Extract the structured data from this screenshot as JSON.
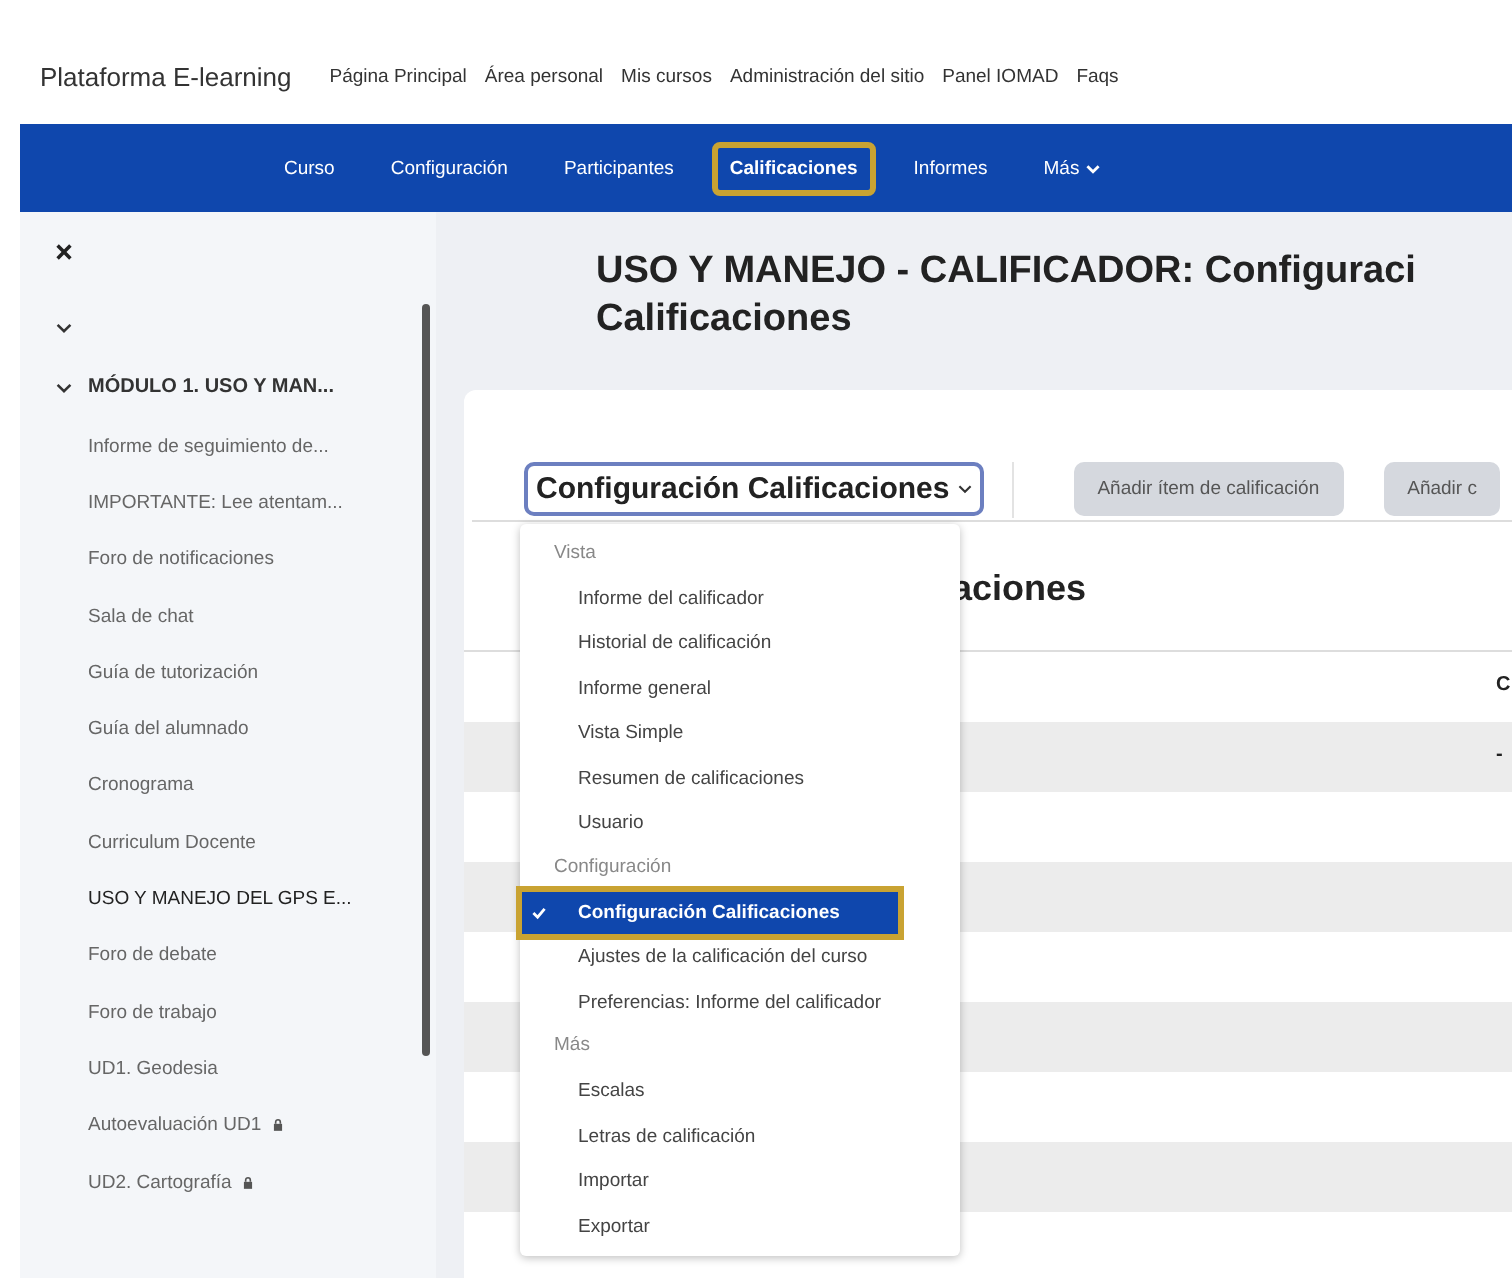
{
  "site_name": "Plataforma E-learning",
  "top_nav": [
    "Página Principal",
    "Área personal",
    "Mis cursos",
    "Administración del sitio",
    "Panel IOMAD",
    "Faqs"
  ],
  "course_nav": [
    {
      "label": "Curso",
      "selected": false
    },
    {
      "label": "Configuración",
      "selected": false
    },
    {
      "label": "Participantes",
      "selected": false
    },
    {
      "label": "Calificaciones",
      "selected": true
    },
    {
      "label": "Informes",
      "selected": false
    },
    {
      "label": "Más",
      "selected": false,
      "kind": "menu"
    }
  ],
  "sidebar": {
    "section": {
      "title": "MÓDULO 1. USO Y MAN...",
      "expanded": true,
      "items": [
        {
          "label": "Informe de seguimiento de...",
          "locked": false,
          "selected": false
        },
        {
          "label": "IMPORTANTE: Lee atentam...",
          "locked": false,
          "selected": false
        },
        {
          "label": "Foro de notificaciones",
          "locked": false,
          "selected": false
        },
        {
          "label": "Sala de chat",
          "locked": false,
          "selected": false
        },
        {
          "label": "Guía de tutorización",
          "locked": false,
          "selected": false
        },
        {
          "label": "Guía del alumnado",
          "locked": false,
          "selected": false
        },
        {
          "label": "Cronograma",
          "locked": false,
          "selected": false
        },
        {
          "label": "Curriculum Docente",
          "locked": false,
          "selected": false
        },
        {
          "label": "USO Y MANEJO DEL GPS E...",
          "locked": false,
          "selected": true
        },
        {
          "label": "Foro de debate",
          "locked": false,
          "selected": false
        },
        {
          "label": "Foro de trabajo",
          "locked": false,
          "selected": false
        },
        {
          "label": "UD1. Geodesia",
          "locked": false,
          "selected": false
        },
        {
          "label": "Autoevaluación UD1",
          "locked": true,
          "selected": false
        },
        {
          "label": "UD2. Cartografía",
          "locked": true,
          "selected": false
        }
      ]
    }
  },
  "main": {
    "heading_lines": [
      "USO Y MANEJO - CALIFICADOR: Configuraci",
      "Calificaciones"
    ],
    "select_value": "Configuración Calificaciones",
    "buttons": [
      "Añadir ítem de calificación",
      "Añadir c"
    ],
    "section_heading": "aciones",
    "table": {
      "column_header": "C",
      "first_row_cell": "-"
    },
    "dropdown": [
      {
        "label": "Vista",
        "items": [
          {
            "label": "Informe del calificador",
            "selected": false
          },
          {
            "label": "Historial de calificación",
            "selected": false
          },
          {
            "label": "Informe general",
            "selected": false
          },
          {
            "label": "Vista Simple",
            "selected": false
          },
          {
            "label": "Resumen de calificaciones",
            "selected": false
          },
          {
            "label": "Usuario",
            "selected": false
          }
        ]
      },
      {
        "label": "Configuración",
        "items": [
          {
            "label": "Configuración Calificaciones",
            "selected": true
          },
          {
            "label": "Ajustes de la calificación del curso",
            "selected": false
          },
          {
            "label": "Preferencias: Informe del calificador",
            "selected": false
          }
        ]
      },
      {
        "label": "Más",
        "items": [
          {
            "label": "Escalas",
            "selected": false
          },
          {
            "label": "Letras de calificación",
            "selected": false
          },
          {
            "label": "Importar",
            "selected": false
          },
          {
            "label": "Exportar",
            "selected": false
          }
        ]
      }
    ]
  }
}
